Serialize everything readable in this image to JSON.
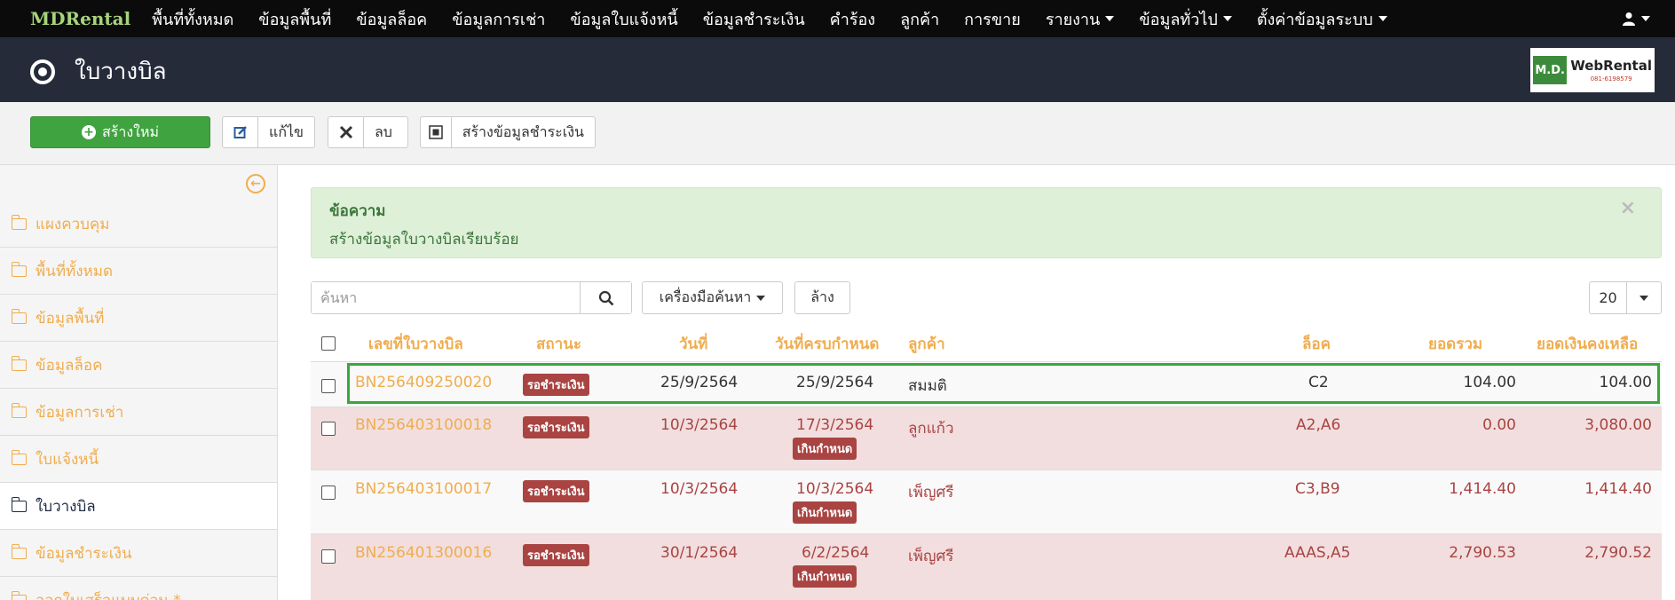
{
  "navbar": {
    "brand": "MDRental",
    "items": [
      {
        "label": "พื้นที่ทั้งหมด",
        "dropdown": false
      },
      {
        "label": "ข้อมูลพื้นที่",
        "dropdown": false
      },
      {
        "label": "ข้อมูลล็อค",
        "dropdown": false
      },
      {
        "label": "ข้อมูลการเช่า",
        "dropdown": false
      },
      {
        "label": "ข้อมูลใบแจ้งหนี้",
        "dropdown": false
      },
      {
        "label": "ข้อมูลชำระเงิน",
        "dropdown": false
      },
      {
        "label": "คำร้อง",
        "dropdown": false
      },
      {
        "label": "ลูกค้า",
        "dropdown": false
      },
      {
        "label": "การขาย",
        "dropdown": false
      },
      {
        "label": "รายงาน",
        "dropdown": true
      },
      {
        "label": "ข้อมูลทั่วไป",
        "dropdown": true
      },
      {
        "label": "ตั้งค่าข้อมูลระบบ",
        "dropdown": true
      }
    ],
    "user_icon": "user-icon"
  },
  "header": {
    "title": "ใบวางบิล",
    "icon": "dot-circle-icon",
    "logo": {
      "left": "M.D.",
      "main": "WebRental",
      "phone": "081-6198579"
    }
  },
  "toolbar": {
    "new_label": "สร้างใหม่",
    "edit_label": "แก้ไข",
    "delete_label": "ลบ",
    "payment_label": "สร้างข้อมูลชำระเงิน"
  },
  "sidebar": {
    "items": [
      {
        "label": "แผงควบคุม"
      },
      {
        "label": "พื้นที่ทั้งหมด"
      },
      {
        "label": "ข้อมูลพื้นที่"
      },
      {
        "label": "ข้อมูลล็อค"
      },
      {
        "label": "ข้อมูลการเช่า"
      },
      {
        "label": "ใบแจ้งหนี้"
      },
      {
        "label": "ใบวางบิล",
        "active": true
      },
      {
        "label": "ข้อมูลชำระเงิน"
      },
      {
        "label": "ออกใบเสร็จแบบด่วน *"
      }
    ]
  },
  "alert": {
    "title": "ข้อความ",
    "message": "สร้างข้อมูลใบวางบิลเรียบร้อย",
    "close": "×"
  },
  "search": {
    "placeholder": "ค้นหา",
    "tools_label": "เครื่องมือค้นหา",
    "clear_label": "ล้าง",
    "page_size": "20"
  },
  "table": {
    "headers": [
      "เลขที่ใบวางบิล",
      "สถานะ",
      "วันที่",
      "วันที่ครบกำหนด",
      "ลูกค้า",
      "ล็อค",
      "ยอดรวม",
      "ยอดเงินคงเหลือ"
    ],
    "rows": [
      {
        "number": "BN256409250020",
        "status": "รอชำระเงิน",
        "date": "25/9/2564",
        "due": "25/9/2564",
        "overdue": "",
        "customer": "สมมติ",
        "lock": "C2",
        "total": "104.00",
        "balance": "104.00"
      },
      {
        "number": "BN256403100018",
        "status": "รอชำระเงิน",
        "date": "10/3/2564",
        "due": "17/3/2564",
        "overdue": "เกินกำหนด",
        "customer": "ลูกแก้ว",
        "lock": "A2,A6",
        "total": "0.00",
        "balance": "3,080.00"
      },
      {
        "number": "BN256403100017",
        "status": "รอชำระเงิน",
        "date": "10/3/2564",
        "due": "10/3/2564",
        "overdue": "เกินกำหนด",
        "customer": "เพ็ญศรี",
        "lock": "C3,B9",
        "total": "1,414.40",
        "balance": "1,414.40"
      },
      {
        "number": "BN256401300016",
        "status": "รอชำระเงิน",
        "date": "30/1/2564",
        "due": "6/2/2564",
        "overdue": "เกินกำหนด",
        "customer": "เพ็ญศรี",
        "lock": "AAAS,A5",
        "total": "2,790.53",
        "balance": "2,790.52"
      }
    ]
  },
  "colors": {
    "navbar": "#0b0b0b",
    "header": "#262b3a",
    "brand": "#a7d47a",
    "link": "#f0ad4e",
    "success": "#3fa33f",
    "danger": "#a94442",
    "alert_bg": "#dff0d8"
  }
}
